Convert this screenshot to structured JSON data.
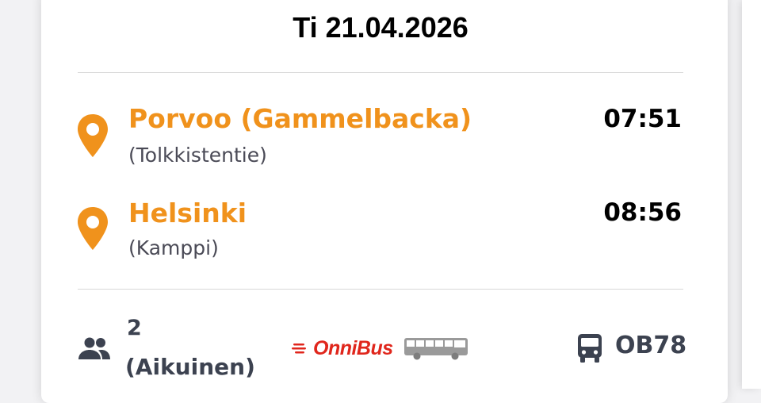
{
  "trip": {
    "date": "Ti 21.04.2026",
    "departure": {
      "stop_name": "Porvoo (Gammelbacka)",
      "stop_detail": "(Tolkkistentie)",
      "time": "07:51"
    },
    "arrival": {
      "stop_name": "Helsinki",
      "stop_detail": "(Kamppi)",
      "time": "08:56"
    }
  },
  "details": {
    "passenger_count": "2",
    "passenger_type": "(Aikuinen)",
    "operator": "OnniBus",
    "route_code": "OB78"
  },
  "icons": {
    "location": "location-pin-icon",
    "passengers": "people-icon",
    "operator_logo": "onnibus-logo",
    "route": "bus-icon"
  },
  "colors": {
    "accent": "#f0921c",
    "text": "#000000",
    "secondary": "#3c4250",
    "brand": "#e0261c"
  }
}
